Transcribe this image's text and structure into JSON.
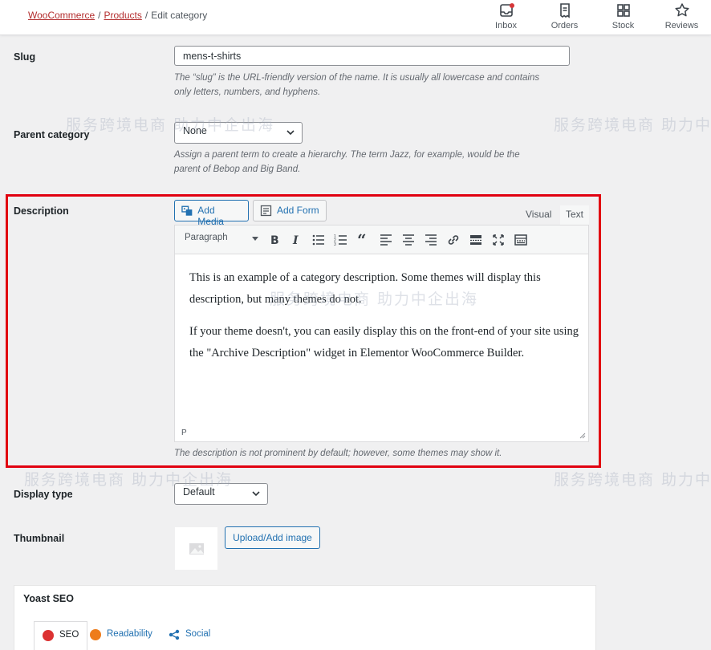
{
  "breadcrumb": {
    "woocommerce": "WooCommerce",
    "products": "Products",
    "current": "Edit category",
    "separator": "/"
  },
  "top_actions": [
    {
      "label": "Inbox",
      "icon": "inbox-icon"
    },
    {
      "label": "Orders",
      "icon": "orders-icon"
    },
    {
      "label": "Stock",
      "icon": "stock-icon"
    },
    {
      "label": "Reviews",
      "icon": "star-icon"
    }
  ],
  "slug": {
    "label": "Slug",
    "value": "mens-t-shirts",
    "help_1": "The “slug” is the URL-friendly version of the name. It is usually all lowercase and contains",
    "help_2": "only letters, numbers, and hyphens."
  },
  "parent": {
    "label": "Parent category",
    "value": "None",
    "help_1": "Assign a parent term to create a hierarchy. The term Jazz, for example, would be the",
    "help_2": "parent of Bebop and Big Band."
  },
  "description": {
    "label": "Description",
    "add_media": "Add Media",
    "add_form": "Add Form",
    "tab_visual": "Visual",
    "tab_text": "Text",
    "format_select": "Paragraph",
    "paragraph_1": "This is an example of a category description. Some themes will display this description, but many themes do not.",
    "paragraph_2": "If your theme doesn't, you can easily display this on the front-end of your site using the \"Archive Description\" widget in Elementor WooCommerce Builder.",
    "path": "P",
    "help": "The description is not prominent by default; however, some themes may show it."
  },
  "display_type": {
    "label": "Display type",
    "value": "Default"
  },
  "thumbnail": {
    "label": "Thumbnail",
    "upload_button": "Upload/Add image"
  },
  "yoast": {
    "title": "Yoast SEO",
    "tabs": [
      {
        "label": "SEO",
        "color": "#dc3232"
      },
      {
        "label": "Readability",
        "color": "#ee7c1b"
      },
      {
        "label": "Social"
      }
    ]
  },
  "watermark": {
    "caption": "服务跨境电商 助力中企出海"
  },
  "colors": {
    "accent": "#2271b1",
    "highlight": "#e10010",
    "link": "#b32d2e"
  }
}
